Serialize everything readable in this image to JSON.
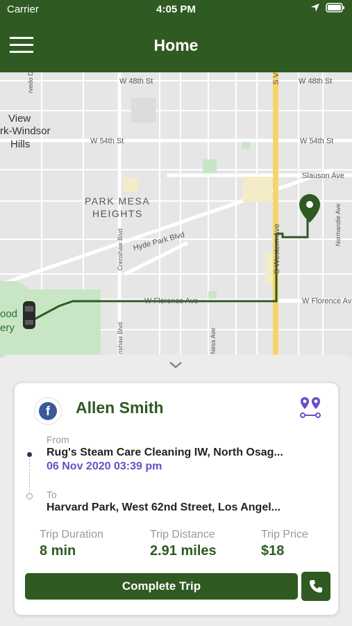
{
  "status_bar": {
    "carrier": "Carrier",
    "time": "4:05 PM"
  },
  "header": {
    "title": "Home"
  },
  "map": {
    "labels": {
      "park_mesa": "PARK MESA",
      "heights": "HEIGHTS",
      "view": "View",
      "windsor": "rk-Windsor",
      "hills": "Hills",
      "w48": "W 48th St",
      "w48b": "W 48th St",
      "w54": "W 54th St",
      "w54b": "W 54th St",
      "slauson": "Slauson Ave",
      "hydepark": "Hyde Park Blvd",
      "florence": "W Florence Ave",
      "florence2": "W Florence Ave",
      "western": "S Western Ave",
      "western_top": "S V",
      "crenshaw": "Crenshaw Blvd",
      "crenshaw2": "nshaw Blvd",
      "ness": "Ness Ave",
      "normandie": "Normandie Ave",
      "ood": "ood",
      "ery": "ery",
      "sepulveda": "rvedo Dr"
    }
  },
  "trip": {
    "driver_name": "Allen Smith",
    "from_label": "From",
    "from_address": "Rug's Steam Care Cleaning IW, North Osag...",
    "from_datetime": "06 Nov 2020 03:39 pm",
    "to_label": "To",
    "to_address": "Harvard Park, West 62nd Street, Los Angel...",
    "duration_label": "Trip Duration",
    "duration_value": "8 min",
    "distance_label": "Trip Distance",
    "distance_value": "2.91 miles",
    "price_label": "Trip Price",
    "price_value": "$18",
    "complete_label": "Complete Trip"
  },
  "colors": {
    "brand_green": "#2f5a22",
    "accent_purple": "#6a4fc5",
    "map_bg": "#e6e6e6",
    "road_yellow": "#f5d56a"
  }
}
